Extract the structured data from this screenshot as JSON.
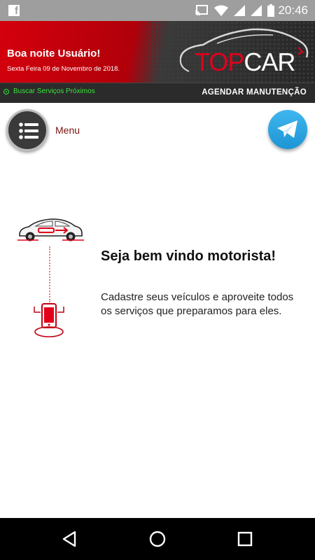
{
  "status_bar": {
    "time": "20:46",
    "icons": [
      "facebook-icon",
      "cast-icon",
      "wifi-icon",
      "signal-icon",
      "signal-icon",
      "battery-icon"
    ]
  },
  "header": {
    "greeting": "Boa noite Usuário!",
    "date": "Sexta Feira 09 de Novembro de 2018.",
    "logo_top": "TOP",
    "logo_car": "CAR"
  },
  "action_bar": {
    "nearby_services": "Buscar Serviços Próximos",
    "schedule_maintenance": "AGENDAR MANUTENÇÃO"
  },
  "toolbar": {
    "menu_label": "Menu"
  },
  "main": {
    "welcome_title": "Seja bem vindo motorista!",
    "welcome_text": "Cadastre seus veículos e aproveite todos os serviços que preparamos para eles."
  },
  "colors": {
    "accent_red": "#e2001a",
    "dark": "#2b2b2b",
    "telegram_blue": "#2ea6e6",
    "status_green": "#39e639"
  }
}
